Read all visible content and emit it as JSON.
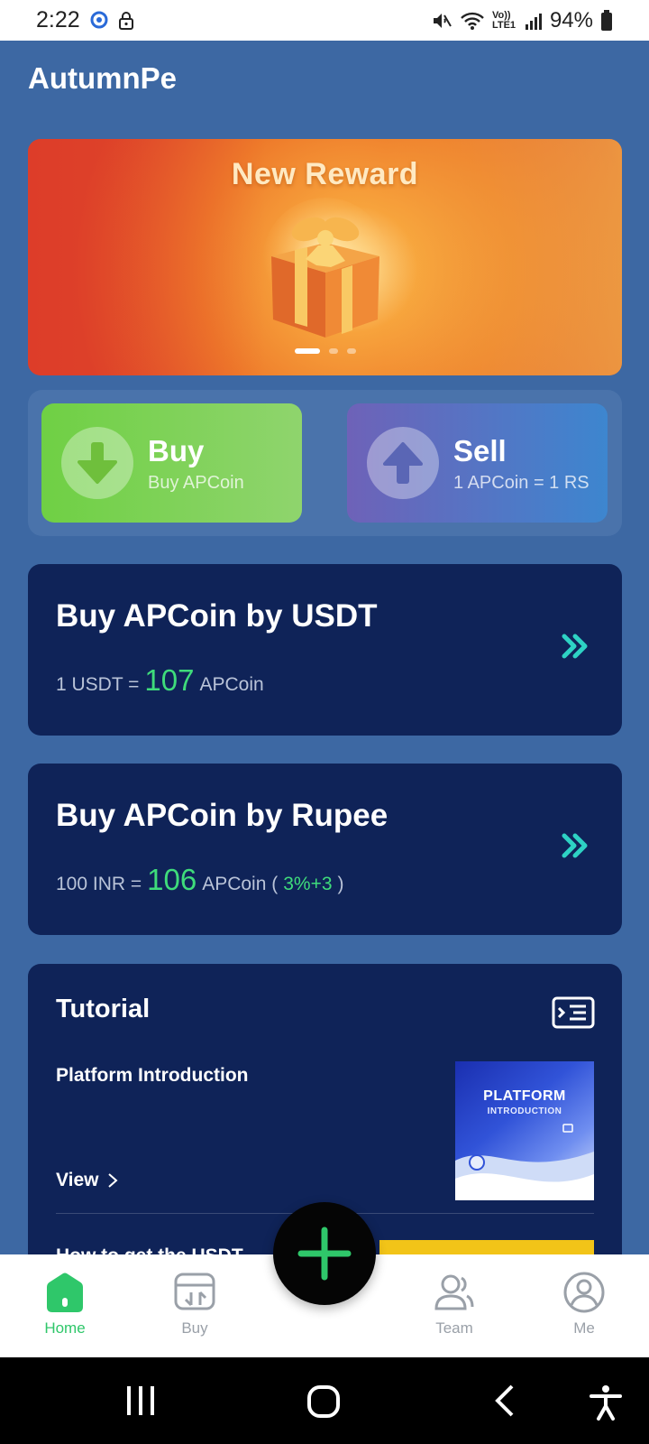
{
  "status_bar": {
    "time": "2:22",
    "battery": "94%",
    "network_label": "Vo)) LTE1"
  },
  "app": {
    "title": "AutumnPe"
  },
  "banner": {
    "title": "New Reward",
    "slide_count": 3,
    "active_slide": 1
  },
  "actions": {
    "buy": {
      "title": "Buy",
      "subtitle": "Buy APCoin"
    },
    "sell": {
      "title": "Sell",
      "subtitle": "1 APCoin = 1 RS"
    }
  },
  "usdt_card": {
    "title": "Buy APCoin by USDT",
    "rate_prefix": "1 USDT =",
    "rate_value": "107",
    "rate_unit": "APCoin"
  },
  "rupee_card": {
    "title": "Buy APCoin by Rupee",
    "rate_prefix": "100 INR =",
    "rate_value": "106",
    "rate_unit": "APCoin (",
    "bonus": "3%+3",
    "rate_suffix": ")"
  },
  "tutorial": {
    "title": "Tutorial",
    "items": [
      {
        "title": "Platform Introduction",
        "action": "View",
        "thumb_title": "PLATFORM",
        "thumb_subtitle": "INTRODUCTION"
      },
      {
        "title": "How to get the USDT"
      }
    ]
  },
  "bottom_nav": {
    "items": [
      {
        "label": "Home",
        "icon": "home-icon",
        "active": true
      },
      {
        "label": "Buy",
        "icon": "exchange-icon",
        "active": false
      },
      {
        "label": "Team",
        "icon": "team-icon",
        "active": false
      },
      {
        "label": "Me",
        "icon": "profile-icon",
        "active": false
      }
    ],
    "fab_icon": "plus-icon"
  },
  "colors": {
    "background": "#3d68a3",
    "card": "#0f2358",
    "accent_green": "#3fdc7b",
    "buy_green": "#6fd044",
    "sell_purple": "#6e62b8"
  }
}
